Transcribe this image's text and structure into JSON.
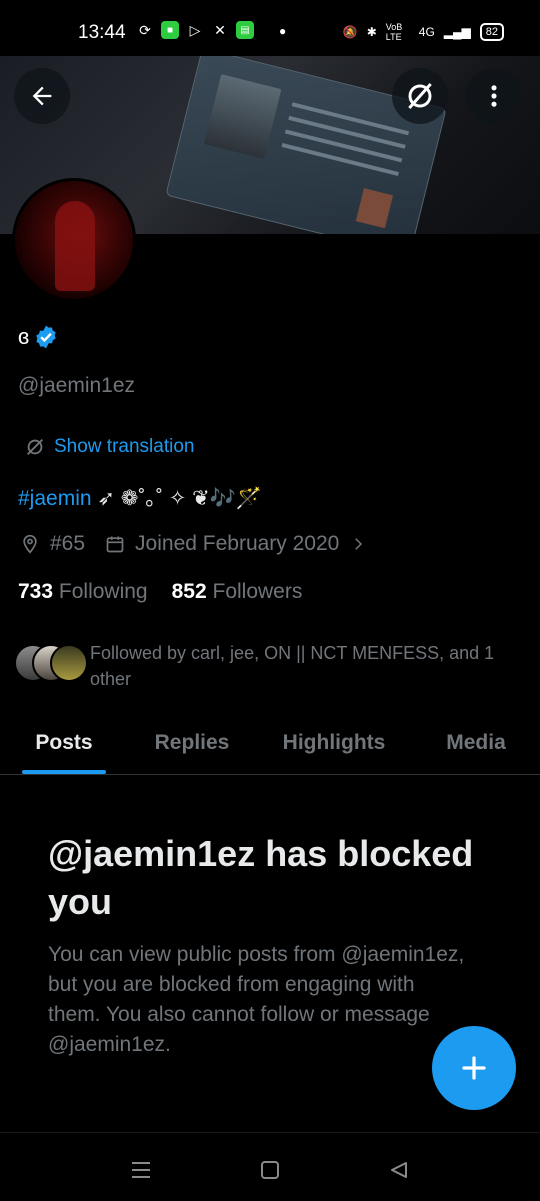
{
  "status_bar": {
    "time": "13:44",
    "battery": "82",
    "network": "4G",
    "volte": "VoB LTE"
  },
  "profile": {
    "display_name": "ɞ",
    "handle": "@jaemin1ez",
    "show_translation": "Show translation",
    "bio_hashtag": "#jaemin",
    "bio_rest": " ➶ ❁˚｡˚ ✧ ❦🎶🪄",
    "location": "#65",
    "joined": "Joined February 2020",
    "following_count": "733",
    "following_label": "Following",
    "followers_count": "852",
    "followers_label": "Followers",
    "followed_by": "Followed by carl, jee, ON || NCT MENFESS, and 1 other"
  },
  "tabs": [
    {
      "label": "Posts"
    },
    {
      "label": "Replies"
    },
    {
      "label": "Highlights"
    },
    {
      "label": "Media"
    }
  ],
  "blocked": {
    "title": "@jaemin1ez has blocked you",
    "body": "You can view public posts from @jaemin1ez, but you are blocked from engaging with them. You also cannot follow or message @jaemin1ez."
  },
  "icons": {
    "back": "back-arrow-icon",
    "translate": "translate-icon",
    "more": "more-vertical-icon",
    "verified": "verified-badge-icon",
    "location": "location-pin-icon",
    "calendar": "calendar-icon",
    "chevron": "chevron-right-icon",
    "compose": "plus-icon"
  },
  "colors": {
    "accent": "#1d9bf0",
    "muted": "#71767b",
    "text": "#e7e9ea",
    "background": "#000000"
  }
}
